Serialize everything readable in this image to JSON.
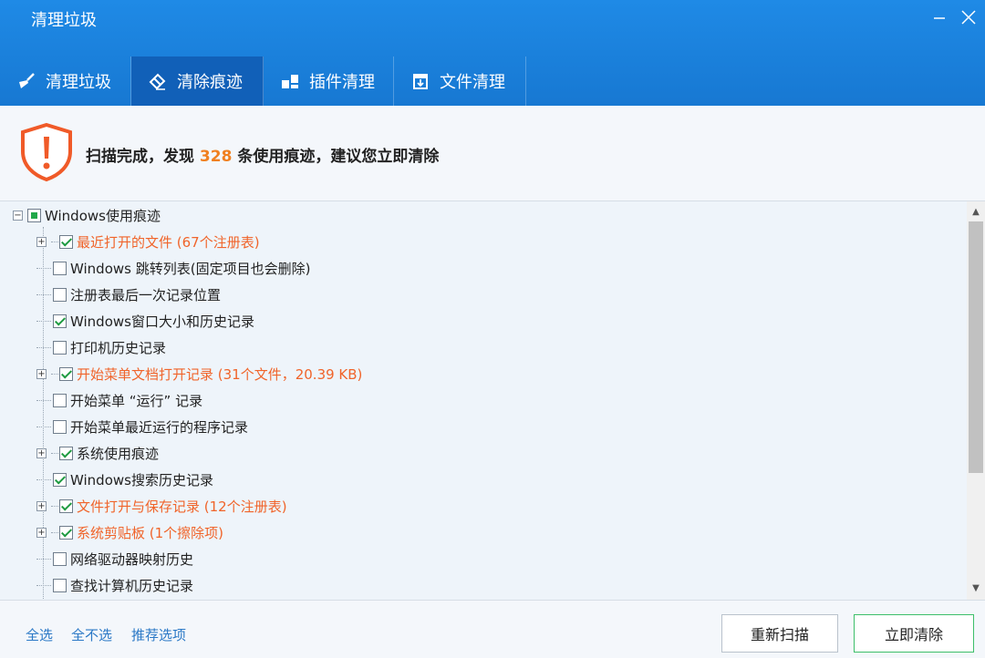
{
  "window": {
    "title": "清理垃圾"
  },
  "tabs": [
    {
      "label": "清理垃圾",
      "icon": "broom-icon"
    },
    {
      "label": "清除痕迹",
      "icon": "eraser-icon",
      "active": true
    },
    {
      "label": "插件清理",
      "icon": "plugin-icon"
    },
    {
      "label": "文件清理",
      "icon": "file-clean-icon"
    }
  ],
  "status": {
    "prefix": "扫描完成，发现",
    "count": "328",
    "suffix": "条使用痕迹，建议您立即清除"
  },
  "tree": {
    "root": {
      "label": "Windows使用痕迹",
      "state": "partial"
    },
    "items": [
      {
        "label": "最近打开的文件 (67个注册表)",
        "checked": true,
        "expandable": true,
        "orange": true
      },
      {
        "label": "Windows 跳转列表(固定项目也会删除)",
        "checked": false,
        "expandable": false,
        "orange": false
      },
      {
        "label": "注册表最后一次记录位置",
        "checked": false,
        "expandable": false,
        "orange": false
      },
      {
        "label": "Windows窗口大小和历史记录",
        "checked": true,
        "expandable": false,
        "orange": false
      },
      {
        "label": "打印机历史记录",
        "checked": false,
        "expandable": false,
        "orange": false
      },
      {
        "label": "开始菜单文档打开记录 (31个文件，20.39 KB)",
        "checked": true,
        "expandable": true,
        "orange": true
      },
      {
        "label": "开始菜单 “运行” 记录",
        "checked": false,
        "expandable": false,
        "orange": false
      },
      {
        "label": "开始菜单最近运行的程序记录",
        "checked": false,
        "expandable": false,
        "orange": false
      },
      {
        "label": "系统使用痕迹",
        "checked": true,
        "expandable": true,
        "orange": false
      },
      {
        "label": "Windows搜索历史记录",
        "checked": true,
        "expandable": false,
        "orange": false
      },
      {
        "label": "文件打开与保存记录 (12个注册表)",
        "checked": true,
        "expandable": true,
        "orange": true
      },
      {
        "label": "系统剪贴板 (1个擦除项)",
        "checked": true,
        "expandable": true,
        "orange": true
      },
      {
        "label": "网络驱动器映射历史",
        "checked": false,
        "expandable": false,
        "orange": false
      },
      {
        "label": "查找计算机历史记录",
        "checked": false,
        "expandable": false,
        "orange": false
      }
    ]
  },
  "footer": {
    "select_all": "全选",
    "select_none": "全不选",
    "recommended": "推荐选项",
    "rescan": "重新扫描",
    "clean_now": "立即清除"
  },
  "colors": {
    "titlebar": "#1778d2",
    "active_tab": "#1160b8",
    "count": "#f08020",
    "orange_item": "#f0642a",
    "link": "#2a78c6",
    "check": "#1e9a40"
  }
}
